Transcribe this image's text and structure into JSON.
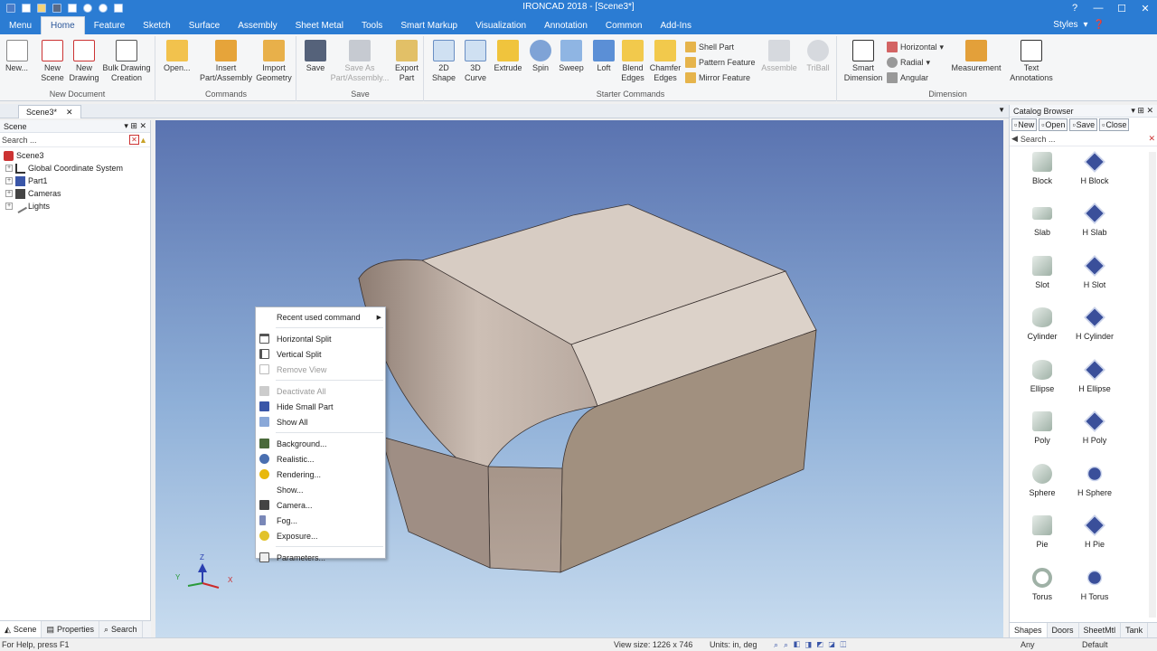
{
  "window": {
    "title": "IRONCAD 2018 - [Scene3*]"
  },
  "menu_tabs": [
    "Menu",
    "Home",
    "Feature",
    "Sketch",
    "Surface",
    "Assembly",
    "Sheet Metal",
    "Tools",
    "Smart Markup",
    "Visualization",
    "Annotation",
    "Common",
    "Add-Ins"
  ],
  "styles_label": "Styles",
  "ribbon": {
    "new_document": {
      "label": "New Document",
      "buttons": [
        "New...",
        "New Scene",
        "New Drawing",
        "Bulk Drawing Creation"
      ]
    },
    "commands": {
      "label": "Commands",
      "buttons": [
        "Open...",
        "Insert Part/Assembly",
        "Import Geometry"
      ]
    },
    "save": {
      "label": "Save",
      "buttons": [
        "Save",
        "Save As Part/Assembly...",
        "Export Part"
      ]
    },
    "starter": {
      "label": "Starter Commands",
      "buttons": [
        "2D Shape",
        "3D Curve",
        "Extrude",
        "Spin",
        "Sweep",
        "Loft",
        "Blend Edges",
        "Chamfer Edges",
        "Assemble",
        "TriBall"
      ],
      "small": [
        "Shell Part",
        "Pattern Feature",
        "Mirror Feature"
      ]
    },
    "dimension": {
      "label": "Dimension",
      "buttons": [
        "Smart Dimension",
        "Measurement",
        "Text Annotations"
      ],
      "small": [
        "Horizontal",
        "Radial",
        "Angular"
      ]
    }
  },
  "doc_tab": "Scene3*",
  "scene_panel": {
    "title": "Scene",
    "search_placeholder": "Search ...",
    "tree": [
      "Scene3",
      "Global Coordinate System",
      "Part1",
      "Cameras",
      "Lights"
    ],
    "bottom_tabs": [
      "Scene",
      "Properties",
      "Search"
    ]
  },
  "catalog": {
    "title": "Catalog Browser",
    "buttons": [
      "New",
      "Open",
      "Save",
      "Close"
    ],
    "search_placeholder": "Search ...",
    "shapes": [
      [
        "Block",
        "H Block"
      ],
      [
        "Slab",
        "H Slab"
      ],
      [
        "Slot",
        "H Slot"
      ],
      [
        "Cylinder",
        "H Cylinder"
      ],
      [
        "Ellipse",
        "H Ellipse"
      ],
      [
        "Poly",
        "H Poly"
      ],
      [
        "Sphere",
        "H Sphere"
      ],
      [
        "Pie",
        "H Pie"
      ],
      [
        "Torus",
        "H Torus"
      ]
    ],
    "tabs": [
      "Shapes",
      "Doors",
      "SheetMtl",
      "Tank"
    ]
  },
  "axis_labels": {
    "z": "Z",
    "y": "Y",
    "x": "X"
  },
  "context_menu": {
    "recent": "Recent used command",
    "items1": [
      "Horizontal Split",
      "Vertical Split",
      "Remove View"
    ],
    "items2": [
      "Deactivate All",
      "Hide Small Part",
      "Show All"
    ],
    "items3": [
      "Background...",
      "Realistic...",
      "Rendering...",
      "Show...",
      "Camera...",
      "Fog...",
      "Exposure..."
    ],
    "items4": [
      "Parameters..."
    ]
  },
  "status": {
    "help": "For Help, press F1",
    "view_size": "View size: 1226 x 746",
    "units": "Units: in, deg",
    "filter": "Any",
    "style": "Default"
  }
}
